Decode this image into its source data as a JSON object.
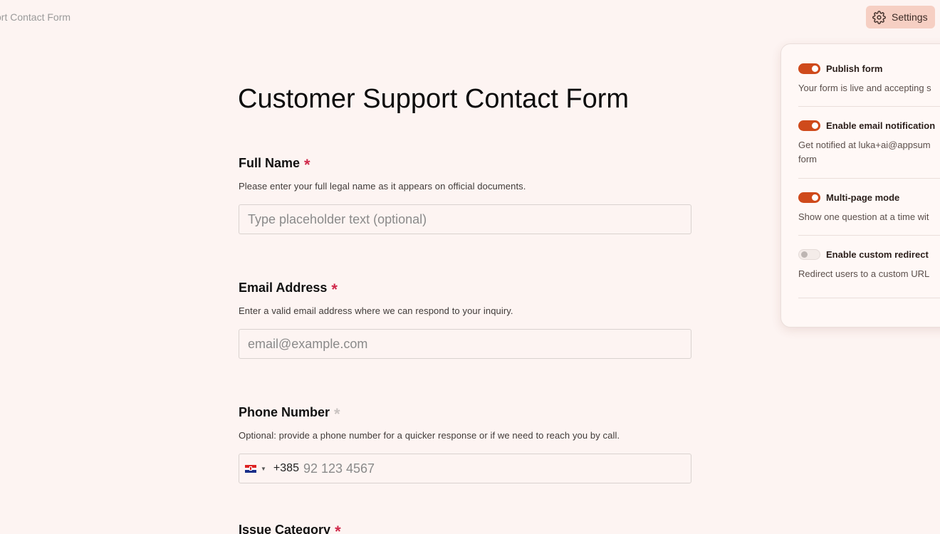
{
  "header": {
    "breadcrumb": "ort Contact Form",
    "settings_label": "Settings"
  },
  "form": {
    "title": "Customer Support Contact Form",
    "fields": [
      {
        "label": "Full Name",
        "required": true,
        "help": "Please enter your full legal name as it appears on official documents.",
        "placeholder": "Type placeholder text (optional)"
      },
      {
        "label": "Email Address",
        "required": true,
        "help": "Enter a valid email address where we can respond to your inquiry.",
        "placeholder": "email@example.com"
      },
      {
        "label": "Phone Number",
        "required": false,
        "help": "Optional: provide a phone number for a quicker response or if we need to reach you by call.",
        "dial_code": "+385",
        "placeholder": "92 123 4567"
      },
      {
        "label": "Issue Category",
        "required": true
      }
    ]
  },
  "settings_panel": {
    "items": [
      {
        "label": "Publish form",
        "enabled": true,
        "description": "Your form is live and accepting s"
      },
      {
        "label": "Enable email notification",
        "enabled": true,
        "description": "Get notified at luka+ai@appsum",
        "description2": "form"
      },
      {
        "label": "Multi-page mode",
        "enabled": true,
        "description": "Show one question at a time wit"
      },
      {
        "label": "Enable custom redirect",
        "enabled": false,
        "description": "Redirect users to a custom URL"
      }
    ]
  },
  "colors": {
    "background": "#fdf4f2",
    "accent": "#cf4a1b",
    "required": "#d0284a",
    "settings_button": "#f6cfc3"
  }
}
